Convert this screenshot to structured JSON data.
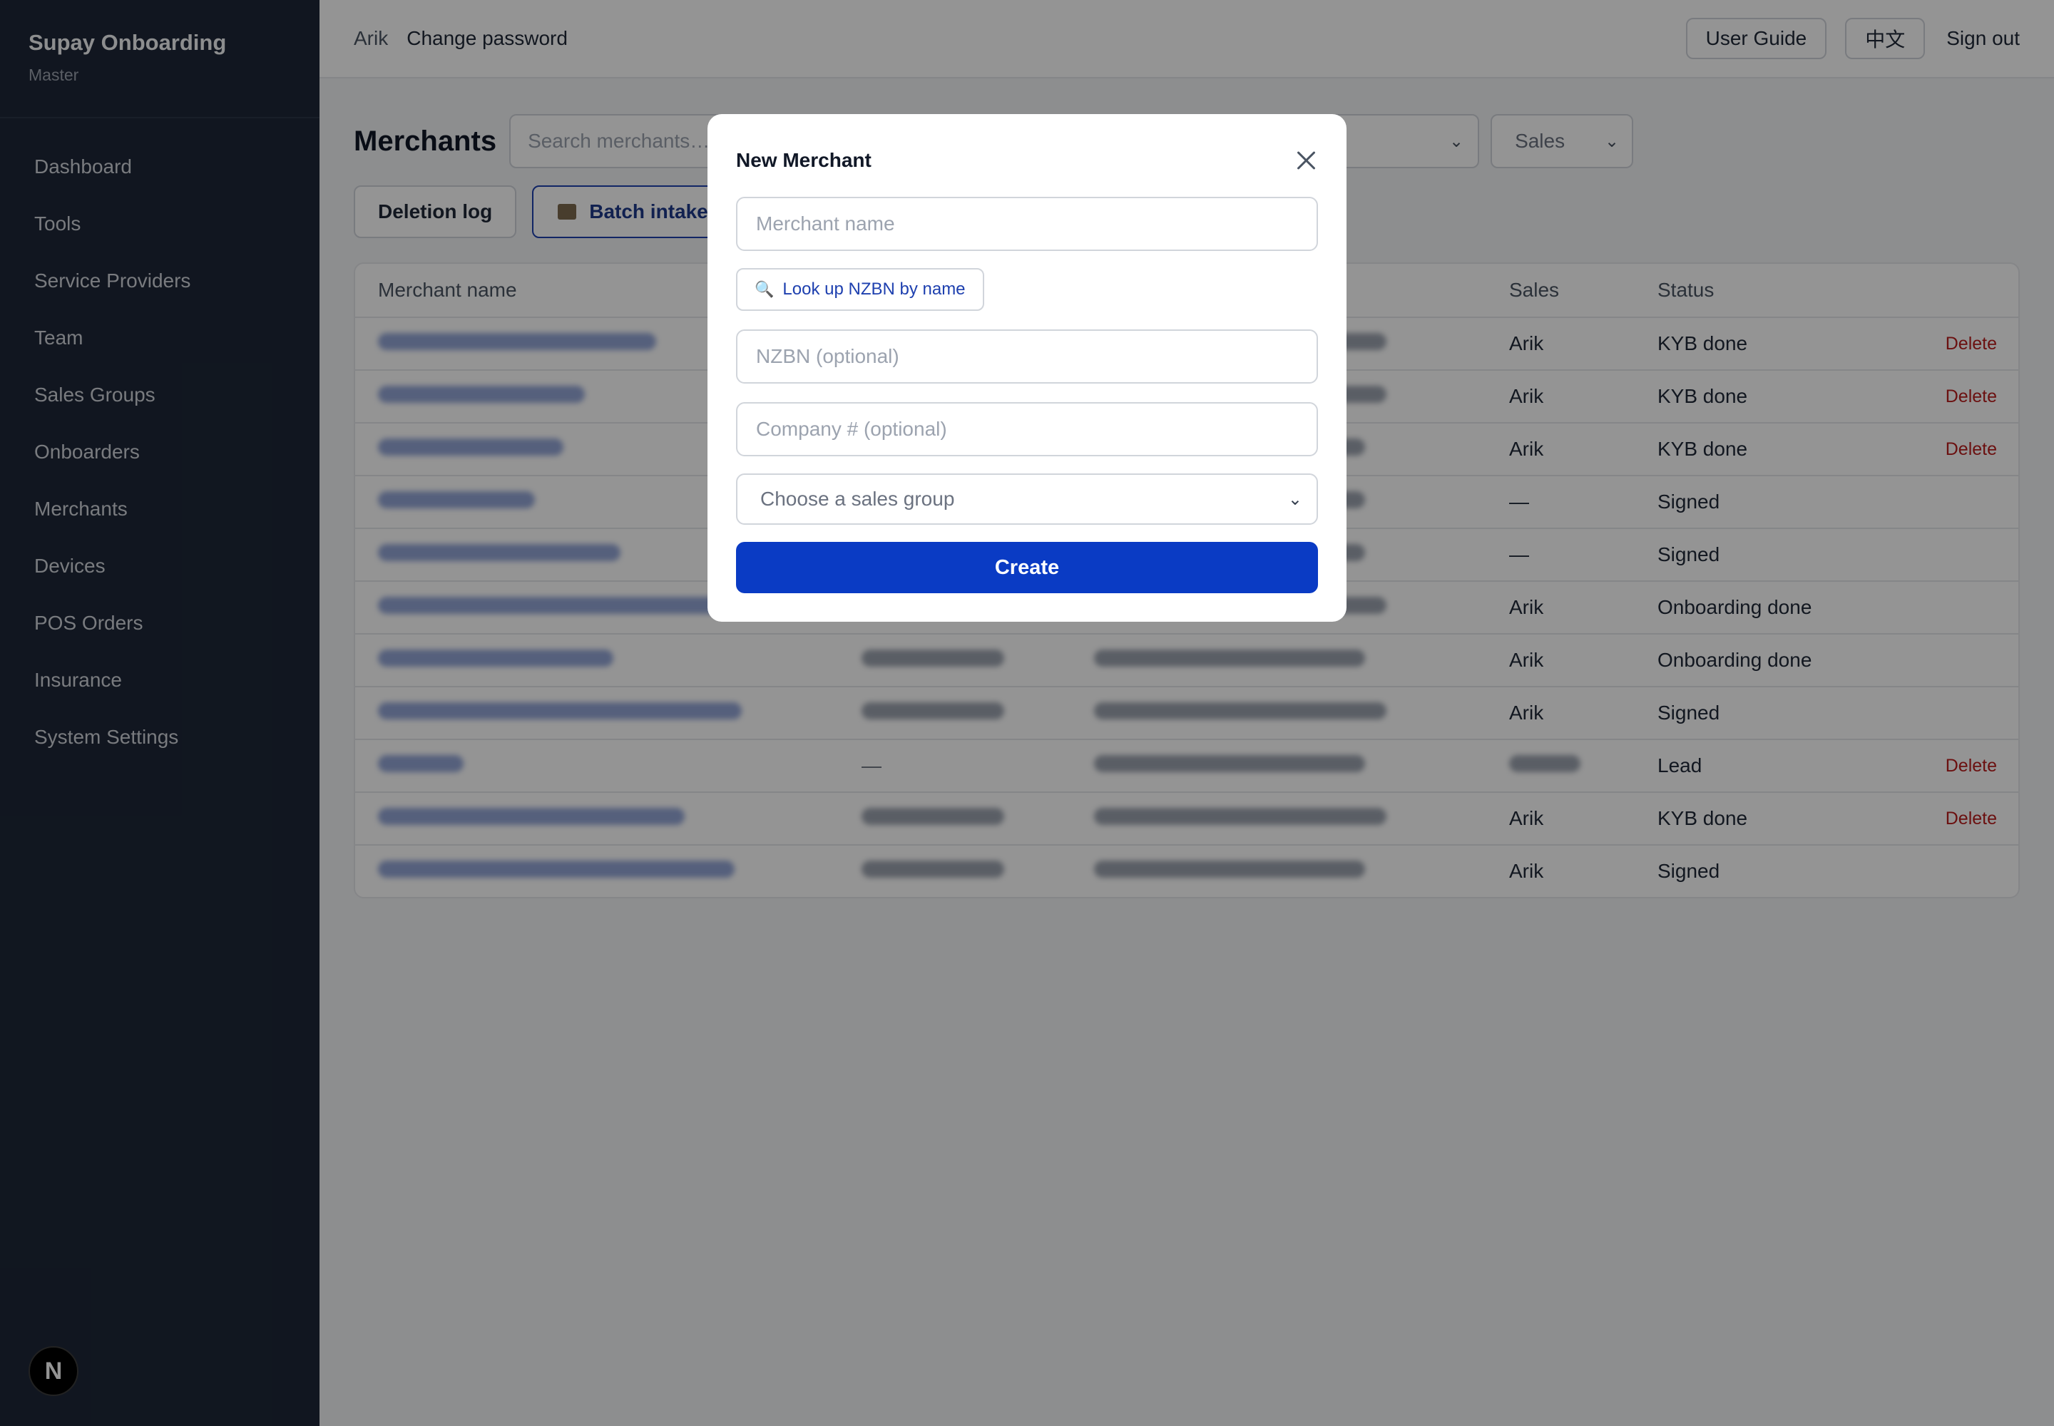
{
  "sidebar": {
    "title": "Supay Onboarding",
    "subtitle": "Master",
    "items": [
      {
        "label": "Dashboard"
      },
      {
        "label": "Tools"
      },
      {
        "label": "Service Providers"
      },
      {
        "label": "Team"
      },
      {
        "label": "Sales Groups"
      },
      {
        "label": "Onboarders"
      },
      {
        "label": "Merchants"
      },
      {
        "label": "Devices"
      },
      {
        "label": "POS Orders"
      },
      {
        "label": "Insurance"
      },
      {
        "label": "System Settings"
      }
    ],
    "badge": "N"
  },
  "topbar": {
    "user": "Arik",
    "change_password": "Change password",
    "user_guide": "User Guide",
    "language": "中文",
    "sign_out": "Sign out"
  },
  "main": {
    "title": "Merchants",
    "search_placeholder": "Search merchants…",
    "sales_filter": "Sales",
    "deletion_log": "Deletion log",
    "batch_intake": "Batch intake",
    "columns": {
      "name": "Merchant name",
      "sales": "Sales",
      "status": "Status"
    },
    "rows": [
      {
        "sales": "Arik",
        "status": "KYB done",
        "action": "Delete"
      },
      {
        "sales": "Arik",
        "status": "KYB done",
        "action": "Delete"
      },
      {
        "sales": "Arik",
        "status": "KYB done",
        "action": "Delete"
      },
      {
        "sales": "—",
        "status": "Signed",
        "action": ""
      },
      {
        "sales": "—",
        "status": "Signed",
        "action": ""
      },
      {
        "sales": "Arik",
        "status": "Onboarding done",
        "action": ""
      },
      {
        "sales": "Arik",
        "status": "Onboarding done",
        "action": ""
      },
      {
        "sales": "Arik",
        "status": "Signed",
        "action": ""
      },
      {
        "sales": "",
        "status": "Lead",
        "action": "Delete",
        "nzbn": "—"
      },
      {
        "sales": "Arik",
        "status": "KYB done",
        "action": "Delete"
      },
      {
        "sales": "Arik",
        "status": "Signed",
        "action": ""
      }
    ]
  },
  "modal": {
    "title": "New Merchant",
    "merchant_name_placeholder": "Merchant name",
    "lookup_label": "Look up NZBN by name",
    "nzbn_placeholder": "NZBN (optional)",
    "company_placeholder": "Company # (optional)",
    "sales_group_placeholder": "Choose a sales group",
    "create_label": "Create"
  }
}
